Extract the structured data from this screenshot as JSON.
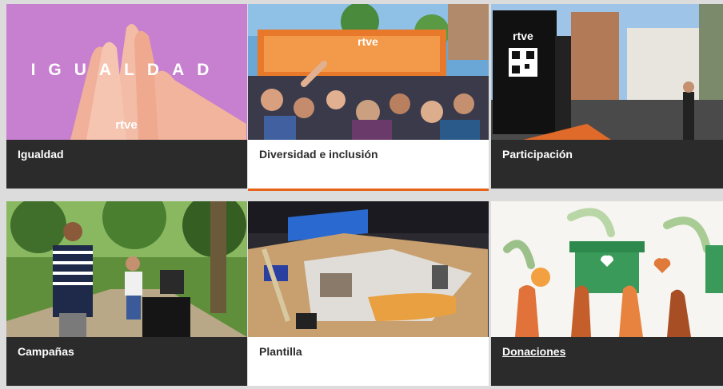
{
  "colors": {
    "page_background": "#dcdcdc",
    "caption_dark": "#2b2b2b",
    "caption_light": "#ffffff",
    "accent_orange": "#e8631a"
  },
  "cards": [
    {
      "label": "Igualdad",
      "image_text": "IGUALDAD",
      "brand": "rtve"
    },
    {
      "label": "Diversidad e inclusión",
      "banner_text": "rtve"
    },
    {
      "label": "Participación",
      "totem_text": "rtve"
    },
    {
      "label": "Campañas"
    },
    {
      "label": "Plantilla"
    },
    {
      "label": "Donaciones"
    }
  ]
}
